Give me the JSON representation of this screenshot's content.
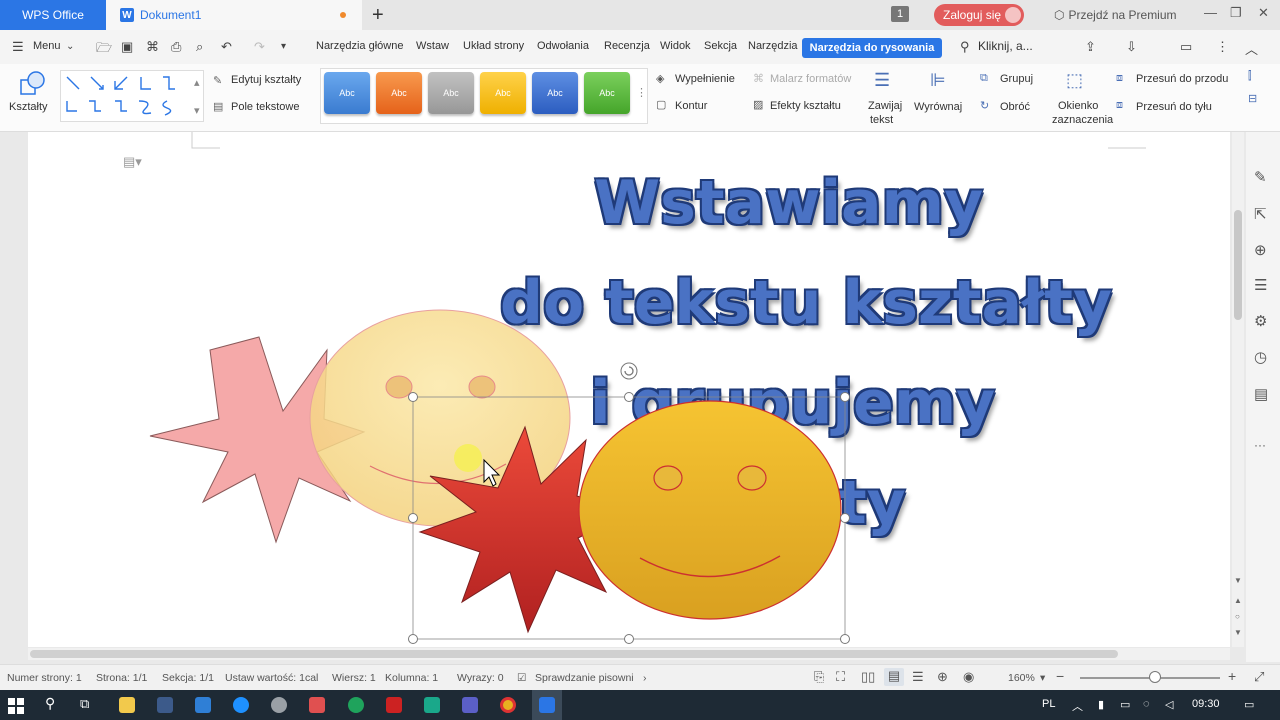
{
  "titlebar": {
    "app_name": "WPS Office",
    "doc_tab": "Dokument1",
    "doc_badge": "W",
    "new_tab": "+",
    "tab_count": "1",
    "login": "Zaloguj się",
    "premium": "Przejdź na Premium"
  },
  "menubar": {
    "menu": "Menu",
    "tabs": [
      "Narzędzia główne",
      "Wstaw",
      "Układ strony",
      "Odwołania",
      "Recenzja",
      "Widok",
      "Sekcja",
      "Narzędzia"
    ],
    "active_tab": "Narzędzia do rysowania",
    "search": "Kliknij, a..."
  },
  "ribbon": {
    "shapes": "Kształty",
    "edit_shapes": "Edytuj kształty",
    "text_box": "Pole tekstowe",
    "style_label": "Abc",
    "styles": [
      "#4a8fe0",
      "#f07a2a",
      "#a9a9a9",
      "#f5bd0a",
      "#3d6fd2",
      "#5aba3c"
    ],
    "fill": "Wypełnienie",
    "format_painter": "Malarz formatów",
    "outline": "Kontur",
    "shape_effects": "Efekty kształtu",
    "wrap_text": [
      "Zawijaj",
      "tekst"
    ],
    "align": "Wyrównaj",
    "group": "Grupuj",
    "rotate": "Obróć",
    "selection_pane": [
      "Okienko",
      "zaznaczenia"
    ],
    "bring_forward": "Przesuń do przodu",
    "send_backward": "Przesuń do tyłu"
  },
  "document": {
    "heading": [
      "Wstawiamy",
      "do tekstu kształty",
      "i grupujemy",
      "ty"
    ]
  },
  "statusbar": {
    "page_number": "Numer strony: 1",
    "page": "Strona: 1/1",
    "section": "Sekcja: 1/1",
    "setting": "Ustaw wartość: 1cal",
    "row": "Wiersz: 1",
    "column": "Kolumna: 1",
    "words": "Wyrazy: 0",
    "spelling": "Sprawdzanie pisowni",
    "zoom": "160%"
  },
  "taskbar": {
    "lang": "PL",
    "time": "09:30"
  }
}
